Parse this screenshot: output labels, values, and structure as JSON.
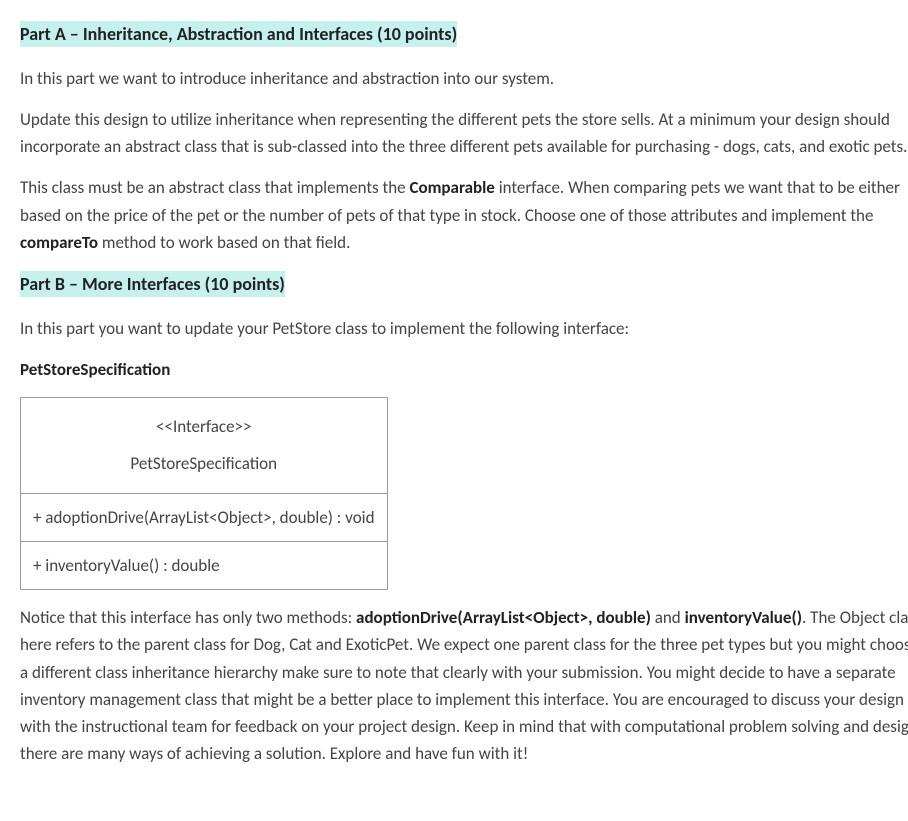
{
  "partA": {
    "heading": "Part A – Inheritance,  Abstraction and Interfaces (10 points)",
    "p1": "In this part we want to introduce inheritance and abstraction into our system.",
    "p2": "Update this design to utilize inheritance when representing the different pets the store sells. At a minimum your design should incorporate an abstract class that is sub-classed into the three different pets available for purchasing - dogs, cats, and exotic pets.",
    "p3_pre": "This class must be an abstract class that implements the ",
    "p3_b1": "Comparable",
    "p3_mid": " interface.  When comparing pets we want that to be either based on the price of the pet or the number of pets of that type in stock. Choose one of those attributes and implement the ",
    "p3_b2": "compareTo",
    "p3_post": " method to work based on that field."
  },
  "partB": {
    "heading": "Part B – More Interfaces (10 points)",
    "p1": "In this part you want to update your PetStore class to implement the following interface:",
    "spec_label": "PetStoreSpecification",
    "uml": {
      "stereotype": "<<Interface>>",
      "name": "PetStoreSpecification",
      "row1": "+ adoptionDrive(ArrayList<Object>, double) : void",
      "row2": "+ inventoryValue() : double"
    },
    "p2_pre": "Notice that this interface has only two methods: ",
    "p2_b1": "adoptionDrive(ArrayList<Object>, double)",
    "p2_mid1": " and ",
    "p2_b2": "inventoryValue()",
    "p2_post": ".  The Object class here refers to the parent class for Dog, Cat and ExoticPet. We expect one parent class for the three pet types but you might choose a different class inheritance hierarchy make sure to note that clearly with your submission. You might decide to have a separate inventory management class that might be a better place to implement this interface. You are encouraged to discuss your design with the instructional team for feedback on your project design. Keep in mind that with computational problem solving and design there are many ways of achieving a solution. Explore and have fun with it!"
  }
}
